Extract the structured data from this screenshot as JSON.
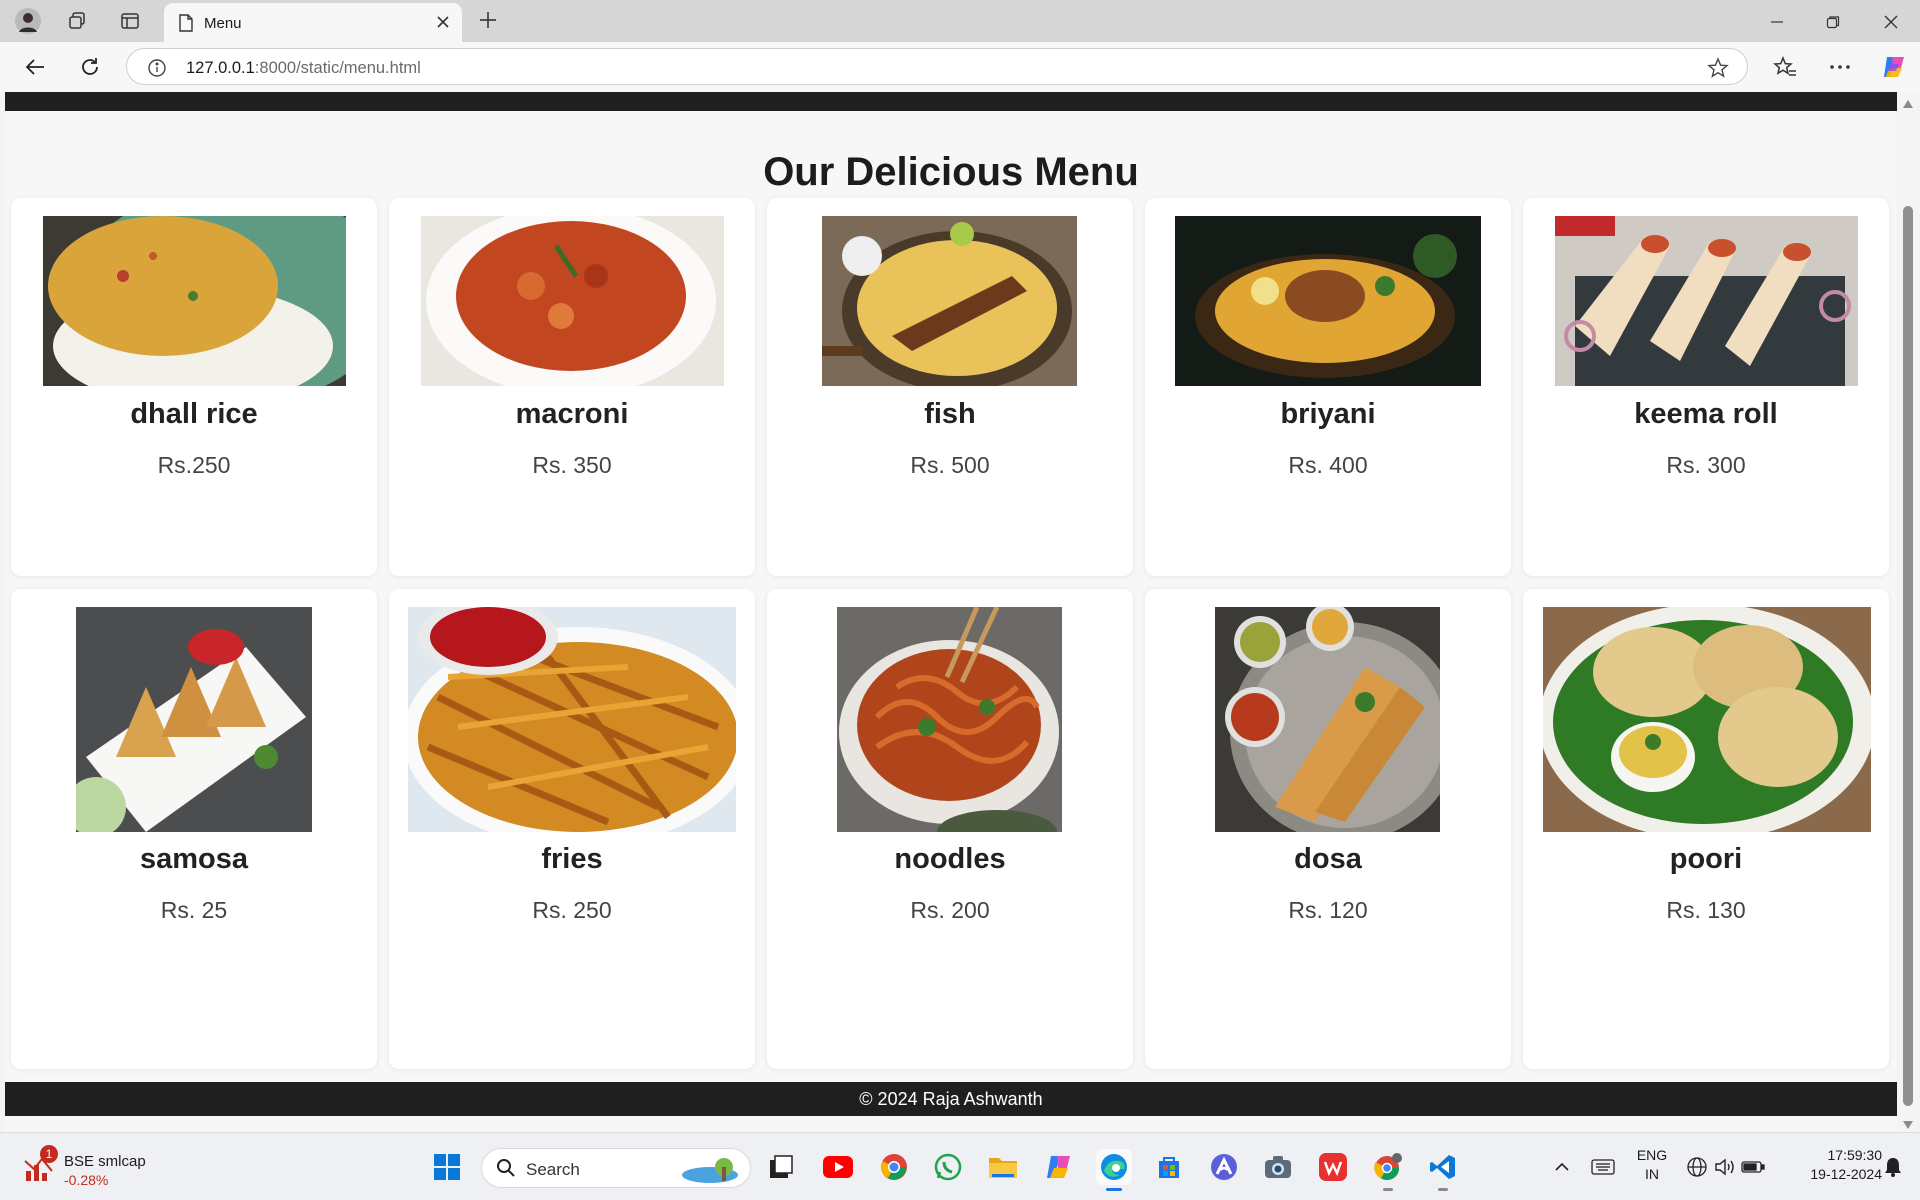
{
  "browser": {
    "tab_title": "Menu",
    "url_host": "127.0.0.1",
    "url_rest": ":8000/static/menu.html"
  },
  "page": {
    "heading": "Our Delicious Menu",
    "items": [
      {
        "name": "dhall rice",
        "price": "Rs.250"
      },
      {
        "name": "macroni",
        "price": "Rs. 350"
      },
      {
        "name": "fish",
        "price": "Rs. 500"
      },
      {
        "name": "briyani",
        "price": "Rs. 400"
      },
      {
        "name": "keema roll",
        "price": "Rs. 300"
      },
      {
        "name": "samosa",
        "price": "Rs. 25"
      },
      {
        "name": "fries",
        "price": "Rs. 250"
      },
      {
        "name": "noodles",
        "price": "Rs. 200"
      },
      {
        "name": "dosa",
        "price": "Rs. 120"
      },
      {
        "name": "poori",
        "price": "Rs. 130"
      }
    ],
    "footer": "© 2024 Raja Ashwanth"
  },
  "taskbar": {
    "stock_badge": "1",
    "stock_name": "BSE smlcap",
    "stock_change": "-0.28%",
    "search_label": "Search",
    "lang_line1": "ENG",
    "lang_line2": "IN",
    "time": "17:59:30",
    "date": "19-12-2024"
  }
}
